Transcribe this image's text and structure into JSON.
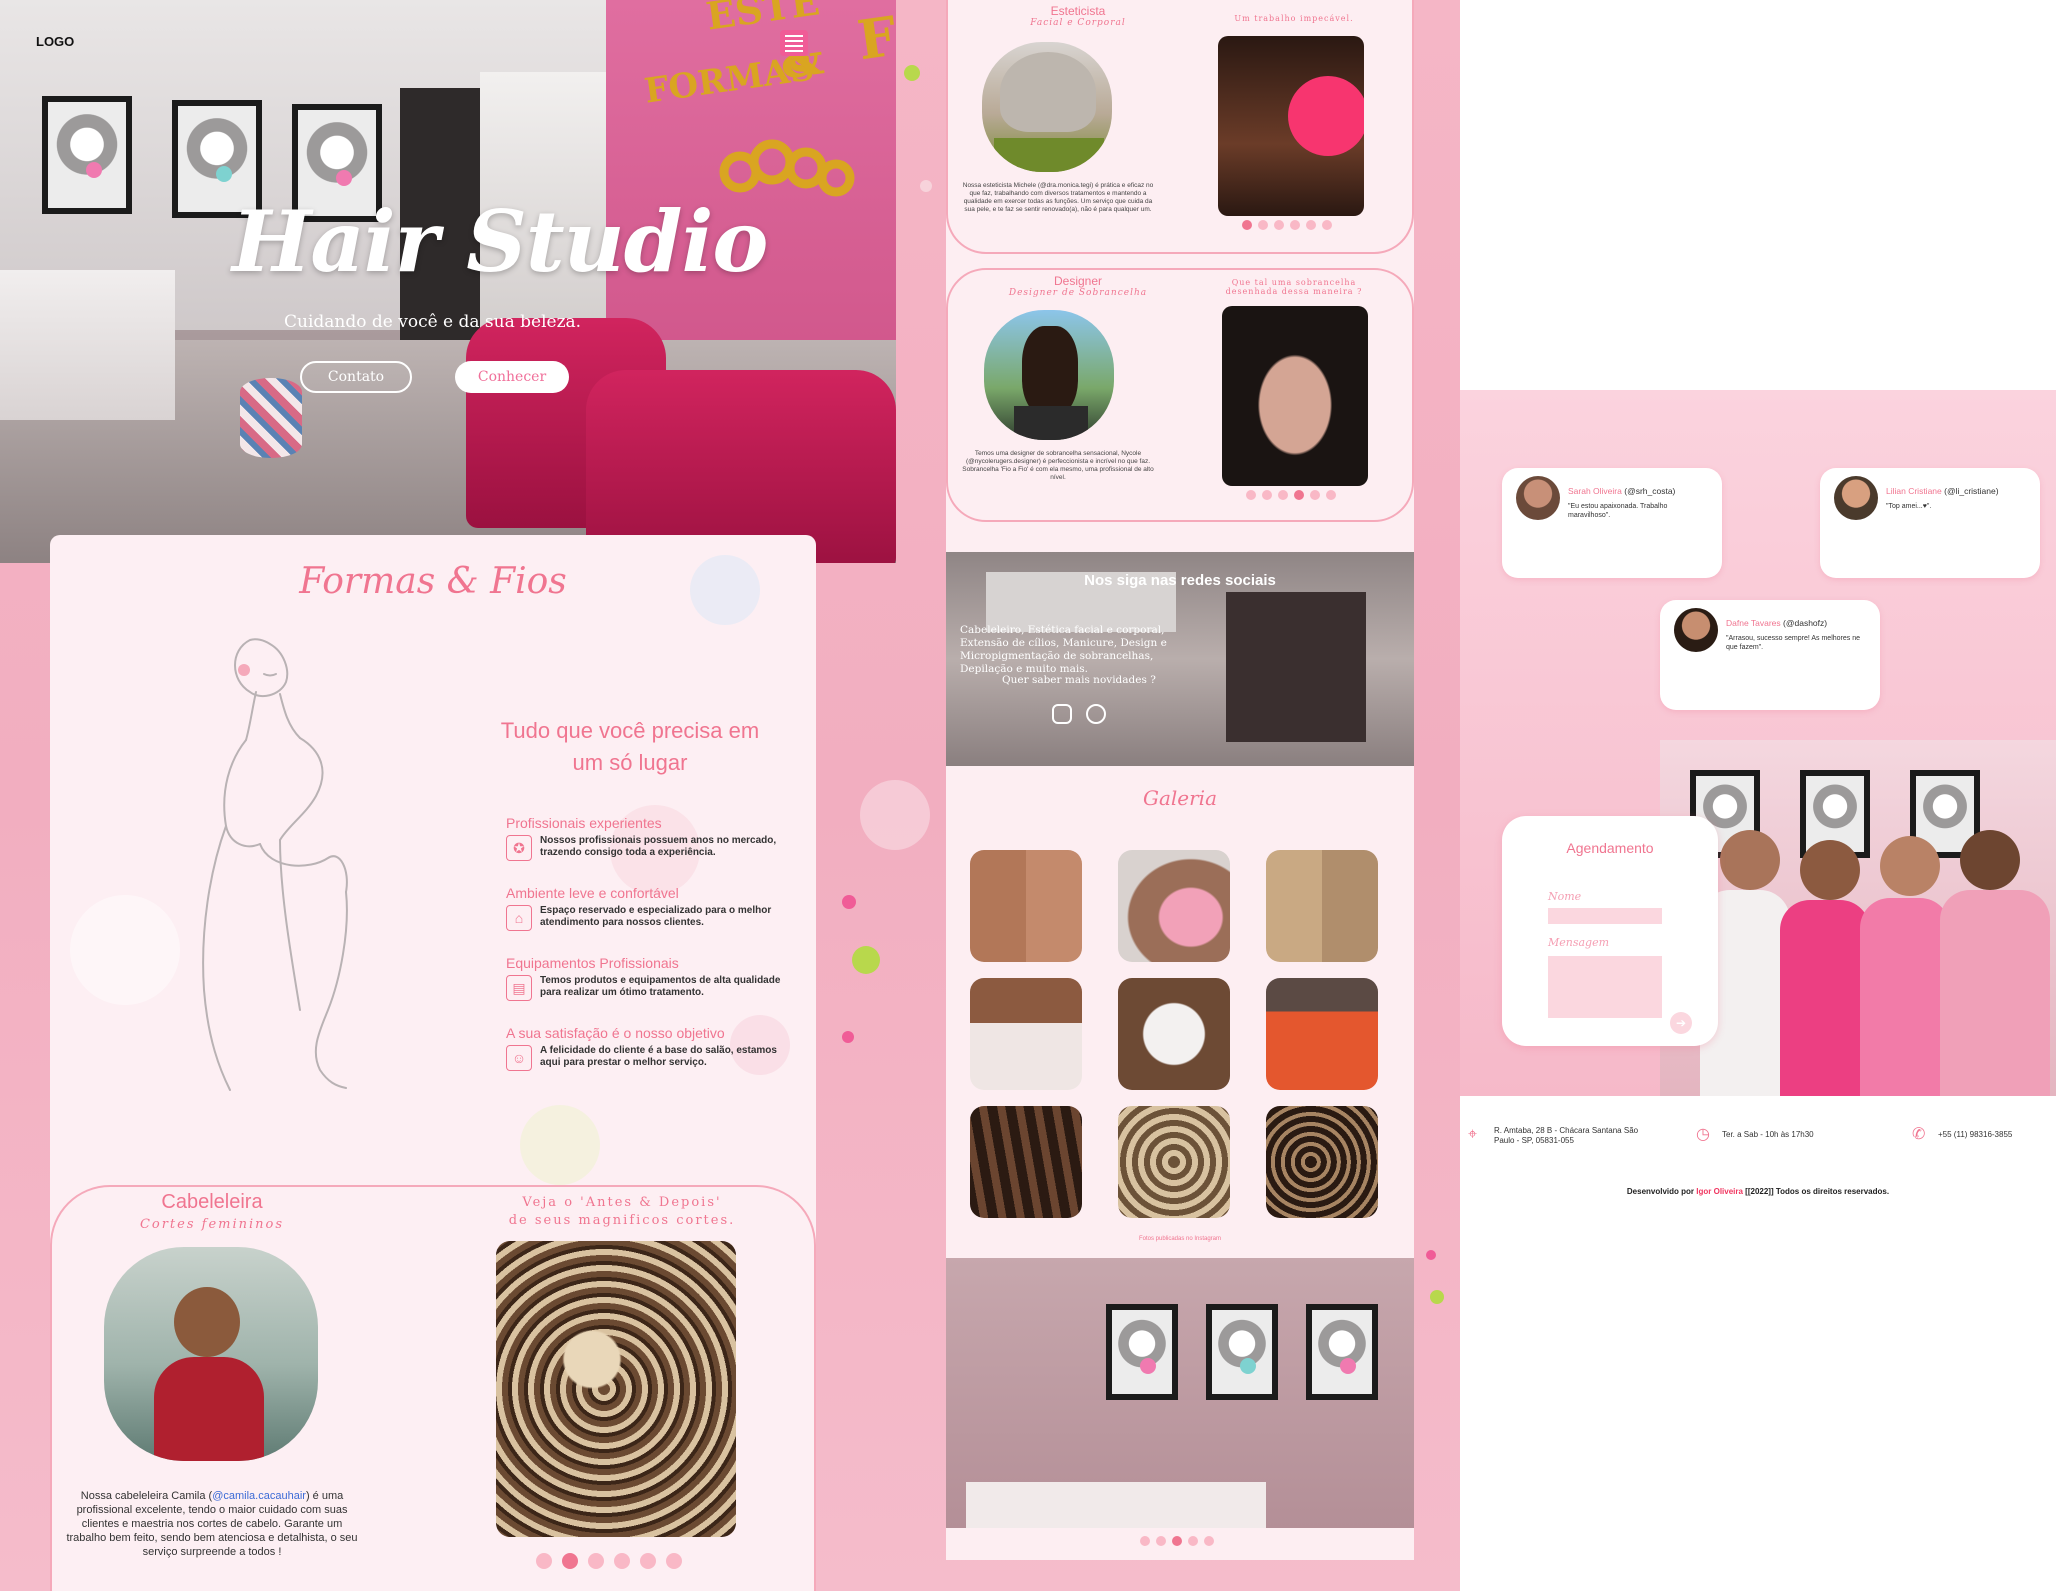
{
  "hero": {
    "logo": "LOGO",
    "title": "Hair Studio",
    "subtitle": "Cuidando de você e da sua beleza.",
    "btn_contact": "Contato",
    "btn_know": "Conhecer",
    "wall_sign_1": "FORMAS",
    "wall_sign_2": "&",
    "wall_sign_top": "ESTÉ",
    "wall_sign_f": "F"
  },
  "about": {
    "brand": "Formas & Fios",
    "heading": "Tudo que você precisa em um só lugar",
    "features": [
      {
        "title": "Profissionais experientes",
        "desc": "Nossos profissionais possuem anos no mercado, trazendo consigo toda a experiência.",
        "icon": "award-icon"
      },
      {
        "title": "Ambiente leve e confortável",
        "desc": "Espaço reservado e especializado para o melhor atendimento para nossos clientes.",
        "icon": "store-icon"
      },
      {
        "title": "Equipamentos Profissionais",
        "desc": "Temos produtos e equipamentos de alta qualidade para realizar um ótimo tratamento.",
        "icon": "products-icon"
      },
      {
        "title": "A sua satisfação é o nosso objetivo",
        "desc": "A felicidade do cliente é a base do salão, estamos aqui para prestar o melhor serviço.",
        "icon": "client-icon"
      }
    ]
  },
  "hairdresser": {
    "title": "Cabeleleira",
    "subtitle": "Cortes femininos",
    "before_after_1": "Veja o 'Antes & Depois'",
    "before_after_2": "de seus magnificos cortes.",
    "desc_1": "Nossa cabeleleira Camila (",
    "mention": "@camila.cacauhair",
    "desc_2": ") é uma profissional excelente, tendo o maior cuidado com suas clientes e maestria nos cortes de cabelo. Garante um trabalho bem feito, sendo bem atenciosa e detalhista, o seu serviço surpreende a todos !"
  },
  "esthetician": {
    "title": "Esteticista",
    "subtitle": "Facial e Corporal",
    "caption": "Um trabalho impecável.",
    "desc": "Nossa esteticista Michele (@dra.monica.tegi) é prática e eficaz no que faz, trabalhando com diversos tratamentos e mantendo a qualidade em exercer todas as funções. Um serviço que cuida da sua pele, e te faz se sentir renovado(a), não é para qualquer um."
  },
  "designer": {
    "title": "Designer",
    "subtitle": "Designer de Sobrancelha",
    "caption": "Que tal uma sobrancelha desenhada dessa maneira ?",
    "desc": "Temos uma designer de sobrancelha sensacional, Nycole (@nycolerugers.designer) é perfeccionista e incrível no que faz. Sobrancelha 'Fio a Fio' é com ela mesmo, uma profissional de alto nível."
  },
  "social": {
    "title": "Nos siga nas redes sociais",
    "desc": "Cabeleleiro, Estética facial e corporal, Extensão de cílios, Manicure, Design e Micropigmentação de sobrancelhas, Depilação e muito mais.",
    "question": "Quer saber mais novidades ?"
  },
  "gallery": {
    "title": "Galeria",
    "footer": "Fotos publicadas no Instagram"
  },
  "testimonials": [
    {
      "name": "Sarah Oliveira",
      "handle": "(@srh_costa)",
      "quote": "\"Eu estou apaixonada. Trabalho maravilhoso\"."
    },
    {
      "name": "Lilian Cristiane",
      "handle": "(@li_cristiane)",
      "quote": "\"Top amei...♥\"."
    },
    {
      "name": "Dafne Tavares",
      "handle": "(@dashofz)",
      "quote": "\"Arrasou, sucesso sempre! As melhores ne que fazem\"."
    }
  ],
  "booking": {
    "title": "Agendamento",
    "name_label": "Nome",
    "message_label": "Mensagem",
    "send_icon": "arrow-right-icon"
  },
  "footer": {
    "address": "R. Amtaba, 28 B - Chácara Santana São Paulo - SP, 05831-055",
    "hours": "Ter. a Sab - 10h às 17h30",
    "phone": "+55 (11) 98316-3855",
    "credits_1": "Desenvolvido por ",
    "developer": "Igor Oliveira",
    "credits_2": " [[2022]] Todos os direitos reservados."
  },
  "colors": {
    "accent": "#f07590",
    "pink_bg": "#f4b9c8",
    "hot_pink": "#f05c97",
    "light_card": "#fdeff3"
  }
}
